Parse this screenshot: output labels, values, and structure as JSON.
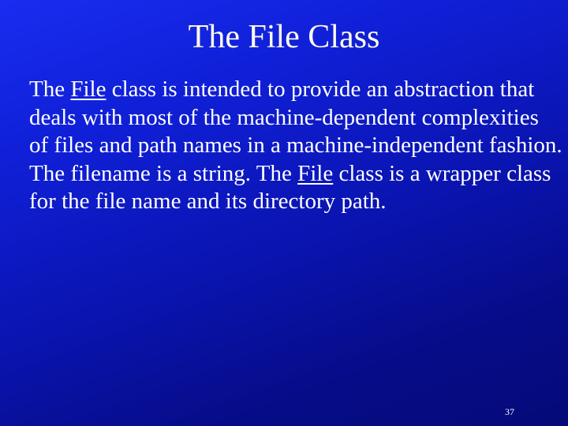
{
  "slide": {
    "title": "The File Class",
    "body_lines": [
      [
        {
          "text": "The ",
          "underline": false
        },
        {
          "text": "File",
          "underline": true
        },
        {
          "text": " class is intended to provide an abstraction that",
          "underline": false
        }
      ],
      [
        {
          "text": "deals with most of the machine-dependent complexities",
          "underline": false
        }
      ],
      [
        {
          "text": "of files and path names in a machine-independent fashion.",
          "underline": false
        }
      ],
      [
        {
          "text": "The filename is a string. The ",
          "underline": false
        },
        {
          "text": "File",
          "underline": true
        },
        {
          "text": " class is a wrapper class",
          "underline": false
        }
      ],
      [
        {
          "text": "for the file name and its directory path.",
          "underline": false
        }
      ]
    ],
    "page_number": "37"
  },
  "colors": {
    "background_top": "#1a2cf0",
    "background_bottom": "#050a78",
    "title_color": "#fffbe6",
    "text_color": "#ffffff"
  }
}
